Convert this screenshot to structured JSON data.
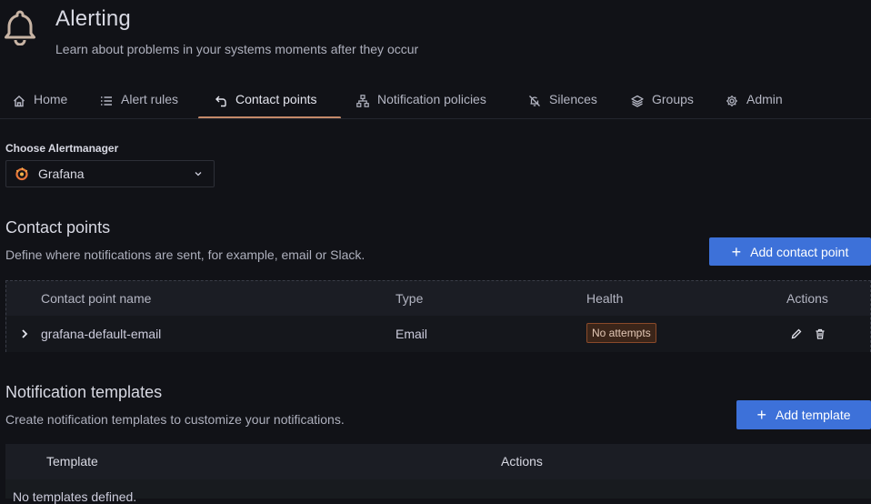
{
  "header": {
    "icon": "bell-icon",
    "title": "Alerting",
    "subtitle": "Learn about problems in your systems moments after they occur"
  },
  "tabs": [
    {
      "label": "Home",
      "icon": "home-icon",
      "active": false
    },
    {
      "label": "Alert rules",
      "icon": "list-icon",
      "active": false
    },
    {
      "label": "Contact points",
      "icon": "contact-icon",
      "active": true
    },
    {
      "label": "Notification policies",
      "icon": "sitemap-icon",
      "active": false
    },
    {
      "label": "Silences",
      "icon": "bell-slash-icon",
      "active": false
    },
    {
      "label": "Groups",
      "icon": "layers-icon",
      "active": false
    },
    {
      "label": "Admin",
      "icon": "cog-icon",
      "active": false
    }
  ],
  "alertmanager": {
    "label": "Choose Alertmanager",
    "selected": "Grafana",
    "icon": "grafana-logo-icon"
  },
  "contact_points": {
    "title": "Contact points",
    "description": "Define where notifications are sent, for example, email or Slack.",
    "add_button": "Add contact point",
    "columns": [
      "Contact point name",
      "Type",
      "Health",
      "Actions"
    ],
    "rows": [
      {
        "name": "grafana-default-email",
        "type": "Email",
        "health": "No attempts"
      }
    ]
  },
  "templates": {
    "title": "Notification templates",
    "description": "Create notification templates to customize your notifications.",
    "add_button": "Add template",
    "columns": [
      "Template",
      "Actions"
    ],
    "empty_text": "No templates defined."
  },
  "colors": {
    "background": "#111217",
    "primary_button": "#3d71d9",
    "tab_accent": "#c48a6a",
    "badge_border": "#8a4a2a"
  }
}
